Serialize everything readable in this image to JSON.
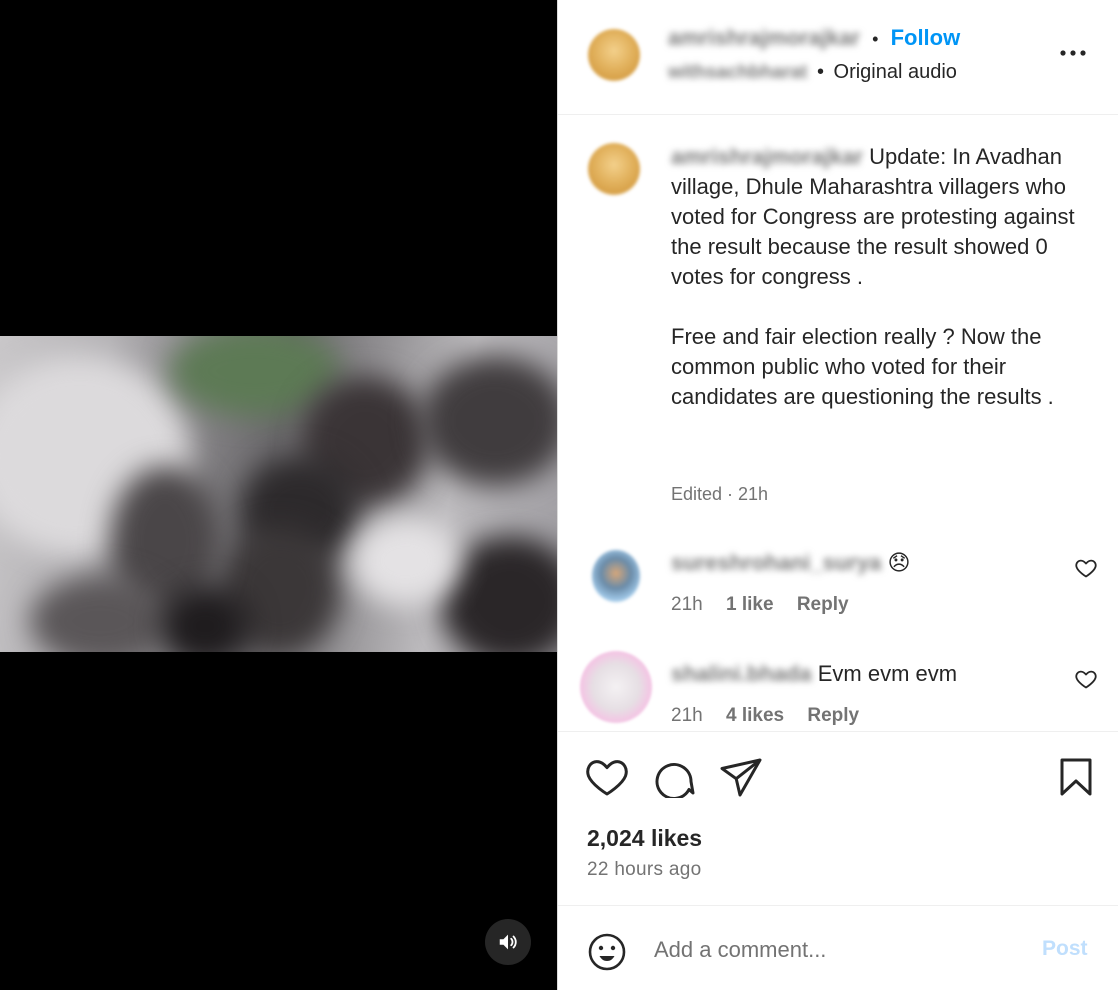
{
  "video": {
    "mute_icon": "speaker-icon"
  },
  "header": {
    "username": "amrishrajmorajkar",
    "separator": "•",
    "follow_label": "Follow",
    "audio_owner": "withsachbharat",
    "audio_separator": "•",
    "audio_label": "Original audio",
    "more_icon": "more-options-icon"
  },
  "caption": {
    "username": "amrishrajmorajkar",
    "text": "Update: In Avadhan village, Dhule Maharashtra villagers who voted for Congress are protesting against the result because the result showed 0 votes for congress .\n\nFree and fair election really ? Now the common public who voted for their candidates are questioning the results .",
    "meta": "Edited · 21h"
  },
  "comments": [
    {
      "username": "sureshrohani_surya",
      "text": "😞",
      "time": "21h",
      "likes": "1 like",
      "reply": "Reply"
    },
    {
      "username": "shalini.bhada",
      "text": "Evm evm evm",
      "time": "21h",
      "likes": "4 likes",
      "reply": "Reply"
    }
  ],
  "actions": {
    "like_icon": "heart-icon",
    "comment_icon": "comment-icon",
    "share_icon": "send-icon",
    "save_icon": "bookmark-icon",
    "likes_count": "2,024 likes",
    "time_ago": "22 hours ago"
  },
  "comment_bar": {
    "emoji_icon": "emoji-icon",
    "placeholder": "Add a comment...",
    "post_label": "Post"
  },
  "colors": {
    "accent": "#0095f6",
    "post_disabled": "#c0dffd",
    "muted_text": "#737373"
  }
}
